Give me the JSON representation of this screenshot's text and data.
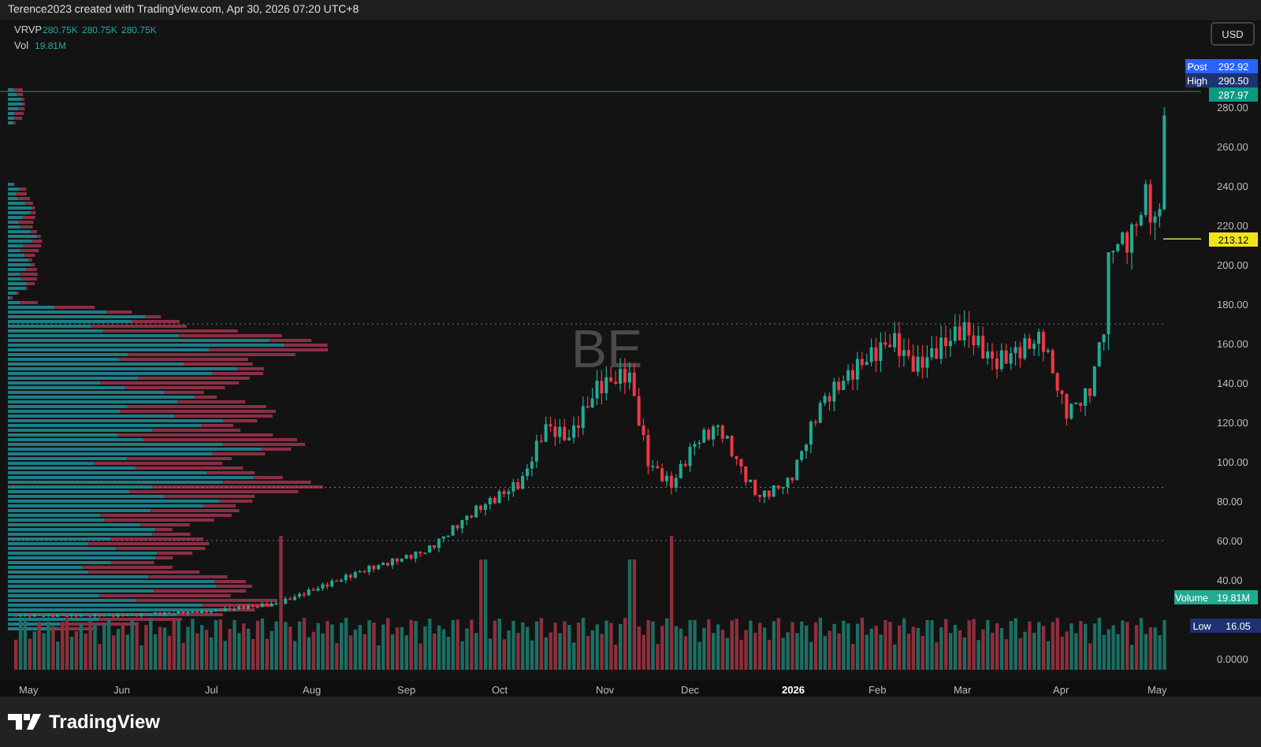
{
  "header": {
    "attribution": "Terence2023 created with TradingView.com, Apr 30, 2026 07:20 UTC+8"
  },
  "legend": [
    {
      "label": "VRVP",
      "values": [
        "280.75K",
        "280.75K",
        "280.75K"
      ]
    },
    {
      "label": "Vol",
      "values": [
        "19.81M"
      ]
    }
  ],
  "symbol_watermark": "BE",
  "currency_button": "USD",
  "price_axis": {
    "ticks": [
      "280.00",
      "260.00",
      "240.00",
      "220.00",
      "200.00",
      "180.00",
      "160.00",
      "140.00",
      "120.00",
      "100.00",
      "80.00",
      "60.00",
      "40.00",
      "0.0000"
    ]
  },
  "price_tags": [
    {
      "kind": "pair",
      "name": "Post",
      "value": "292.92",
      "color": "#2962ff"
    },
    {
      "kind": "pair",
      "name": "High",
      "value": "290.50",
      "color": "#1e3170"
    },
    {
      "kind": "single",
      "value": "287.97",
      "color": "#089981"
    },
    {
      "kind": "single",
      "value": "213.12",
      "color": "#f2e41b"
    },
    {
      "kind": "pair",
      "name": "Volume",
      "value": "19.81M",
      "color": "#22ab94"
    },
    {
      "kind": "pair",
      "name": "Low",
      "value": "16.05",
      "color": "#1e3170"
    }
  ],
  "time_axis": [
    {
      "kind": "month",
      "label": "May"
    },
    {
      "kind": "month",
      "label": "Jun"
    },
    {
      "kind": "month",
      "label": "Jul"
    },
    {
      "kind": "month",
      "label": "Aug"
    },
    {
      "kind": "month",
      "label": "Sep"
    },
    {
      "kind": "month",
      "label": "Oct"
    },
    {
      "kind": "month",
      "label": "Nov"
    },
    {
      "kind": "month",
      "label": "Dec"
    },
    {
      "kind": "year",
      "label": "2026"
    },
    {
      "kind": "month",
      "label": "Feb"
    },
    {
      "kind": "month",
      "label": "Mar"
    },
    {
      "kind": "month",
      "label": "Apr"
    },
    {
      "kind": "month",
      "label": "May"
    }
  ],
  "footer": {
    "logo_text": "TradingView"
  }
}
